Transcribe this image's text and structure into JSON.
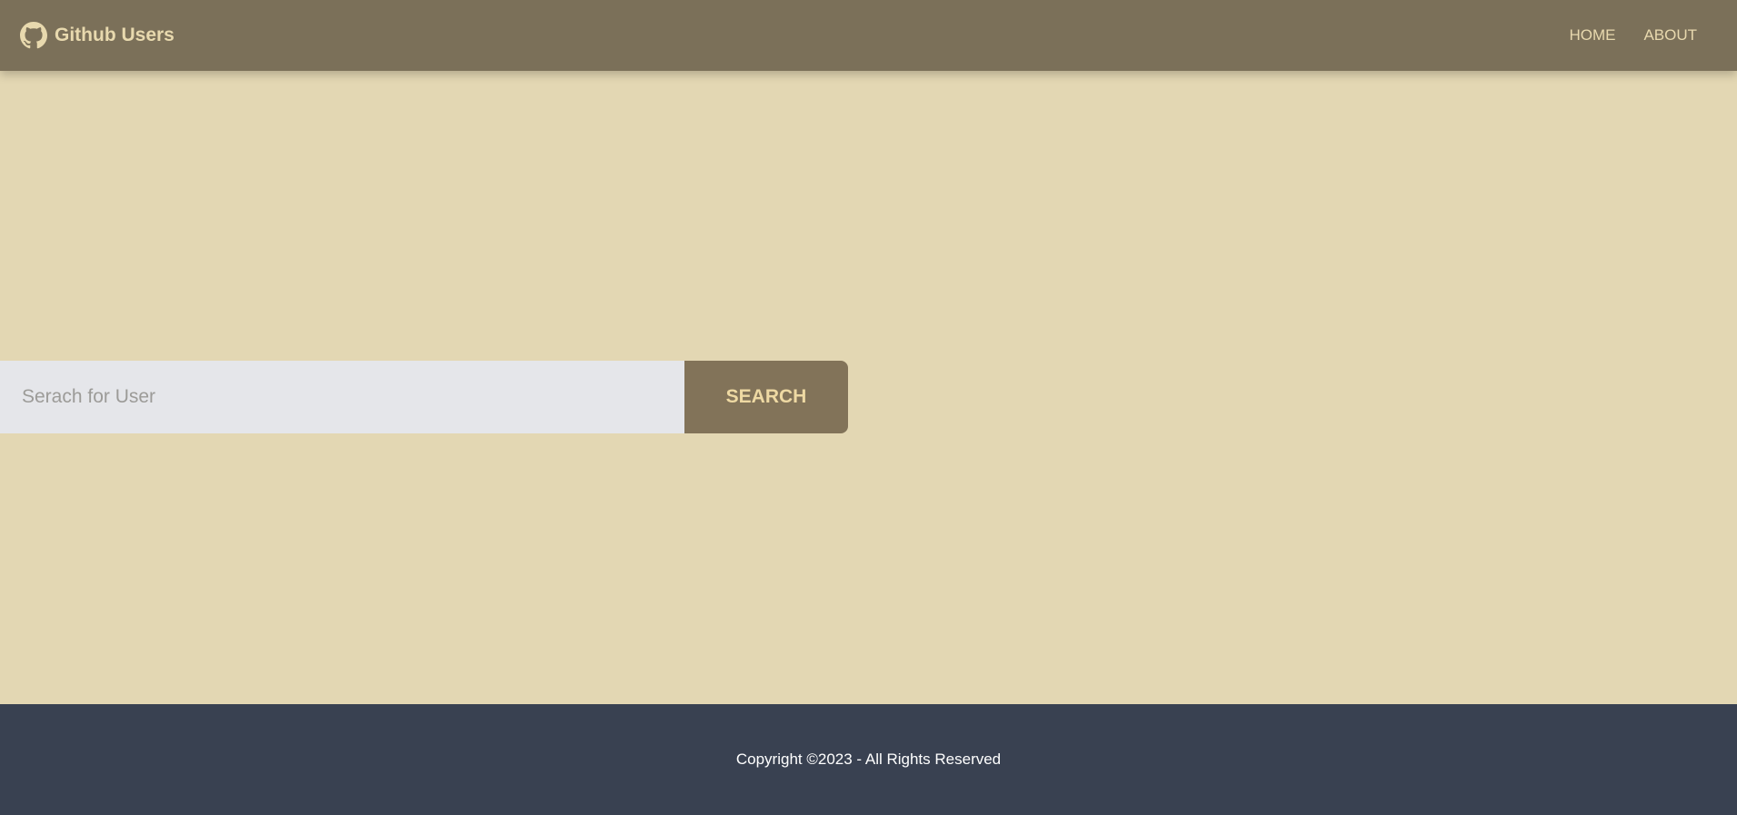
{
  "navbar": {
    "brand_label": "Github Users",
    "brand_icon": "github-icon",
    "links": [
      {
        "label": "HOME"
      },
      {
        "label": "ABOUT"
      }
    ]
  },
  "search": {
    "placeholder": "Serach for User",
    "value": "",
    "button_label": "SEARCH"
  },
  "footer": {
    "text": "Copyright ©2023 - All Rights Reserved"
  },
  "colors": {
    "navbar_bg": "#7b7059",
    "page_bg": "#e3d7b3",
    "accent_text": "#e8d9ae",
    "button_bg": "#827359",
    "input_bg": "#e5e6ea",
    "footer_bg": "#394151"
  }
}
